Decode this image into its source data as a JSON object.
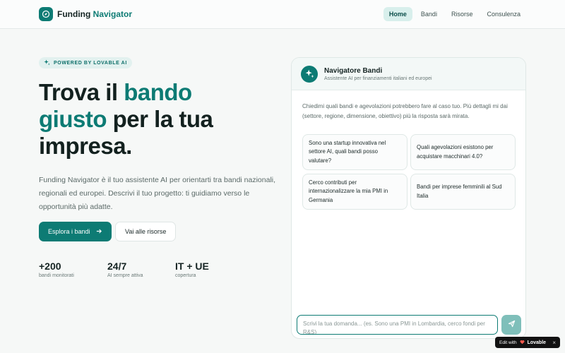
{
  "header": {
    "brand_part1": "Funding",
    "brand_part2": "Navigator",
    "nav": [
      {
        "label": "Home",
        "active": true
      },
      {
        "label": "Bandi",
        "active": false
      },
      {
        "label": "Risorse",
        "active": false
      },
      {
        "label": "Consulenza",
        "active": false
      }
    ]
  },
  "hero": {
    "badge": "POWERED BY LOVABLE AI",
    "title": {
      "part1": "Trova il ",
      "accent1": "bando",
      "accent2": "giusto",
      "part2": " per la tua impresa."
    },
    "description": "Funding Navigator è il tuo assistente AI per orientarti tra bandi nazionali, regionali ed europei. Descrivi il tuo progetto: ti guidiamo verso le opportunità più adatte.",
    "primary_button": "Esplora i bandi",
    "secondary_button": "Vai alle risorse",
    "stats": [
      {
        "value": "+200",
        "label": "bandi monitorati"
      },
      {
        "value": "24/7",
        "label": "AI sempre attiva"
      },
      {
        "value": "IT + UE",
        "label": "copertura"
      }
    ]
  },
  "chat": {
    "title": "Navigatore Bandi",
    "subtitle": "Assistente AI per finanziamenti italiani ed europei",
    "intro": "Chiedimi quali bandi e agevolazioni potrebbero fare al caso tuo. Più dettagli mi dai (settore, regione, dimensione, obiettivo) più la risposta sarà mirata.",
    "suggestions": [
      "Sono una startup innovativa nel settore AI, quali bandi posso valutare?",
      "Quali agevolazioni esistono per acquistare macchinari 4.0?",
      "Cerco contributi per internazionalizzare la mia PMI in Germania",
      "Bandi per imprese femminili al Sud Italia"
    ],
    "input_placeholder": "Scrivi la tua domanda... (es. Sono una PMI in Lombardia, cerco fondi per R&S)"
  },
  "edit_badge": {
    "prefix": "Edit with",
    "brand": "Lovable",
    "close": "×"
  },
  "colors": {
    "accent": "#0d7b74",
    "accent_soft": "#d8efec",
    "send_button": "#7fbfba"
  },
  "icons": [
    "compass-icon",
    "sparkle-icon",
    "arrow-right-icon",
    "send-icon",
    "close-icon"
  ]
}
